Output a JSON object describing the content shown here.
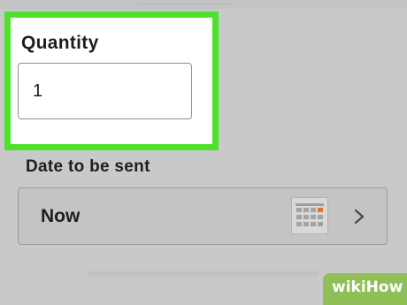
{
  "quantity": {
    "label": "Quantity",
    "value": "1"
  },
  "date": {
    "label": "Date to be sent",
    "value": "Now",
    "calendar_icon": "calendar-icon",
    "chevron_icon": "chevron-right-icon"
  },
  "colors": {
    "highlight": "#4de02c",
    "background": "#c9c9c9",
    "calendar_accent": "#e8731c"
  },
  "watermark": {
    "text": "wikiHow"
  }
}
